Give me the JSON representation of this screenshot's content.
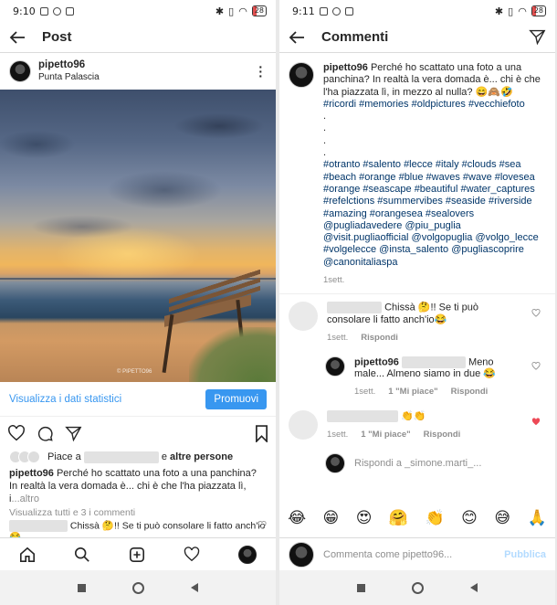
{
  "left": {
    "status": {
      "time": "9:10",
      "battery": "28",
      "battery_level": 0.28
    },
    "topbar": {
      "title": "Post"
    },
    "post": {
      "username": "pipetto96",
      "location": "Punta Palascia",
      "photo_credit": "© PIPETTO96",
      "insights_label": "Visualizza i dati statistici",
      "promote_label": "Promuovi",
      "likes_prefix": "Piace a",
      "likes_and": "e",
      "likes_others": "altre persone",
      "caption_user": "pipetto96",
      "caption_text": "Perché ho scattato una foto a una panchina? In realtà la vera domada è... chi è che l'ha piazzata lì, i",
      "caption_more": "...altro",
      "view_all": "Visualizza tutti e 3 i commenti",
      "preview_comment": "Chissà 🤔!! Se ti può consolare li fatto anch'io😂"
    }
  },
  "right": {
    "status": {
      "time": "9:11",
      "battery": "28",
      "battery_level": 0.28
    },
    "topbar": {
      "title": "Commenti"
    },
    "original": {
      "username": "pipetto96",
      "text": "Perché ho scattato una foto a una panchina? In realtà la vera domada è... chi è che l'ha piazzata lì, in mezzo al nulla? 😄🙈🤣",
      "hashtags_1": "#ricordi #memories #oldpictures #vecchiefoto",
      "dots": [
        ".",
        ".",
        ".",
        "."
      ],
      "hashtags_2": "#otranto #salento #lecce #italy #clouds #sea #beach #orange #blue #waves #wave #lovesea #orange #seascape #beautiful #water_captures #refelctions #summervibes #seaside #riverside #amazing #orangesea #sealovers @pugliadavedere @piu_puglia @visit.pugliaofficial @volgopuglia @volgo_lecce #volgelecce @insta_salento @pugliascoprire @canonitaliaspa",
      "time": "1sett."
    },
    "comments": [
      {
        "text": "Chissà 🤔!! Se ti può consolare li fatto anch'io😂",
        "time": "1sett.",
        "reply_label": "Rispondi",
        "liked": false
      },
      {
        "username": "pipetto96",
        "text": "Meno male... Almeno siamo in due 😂",
        "time": "1sett.",
        "likes": "1 \"Mi piace\"",
        "reply_label": "Rispondi",
        "liked": false
      },
      {
        "text": "👏👏",
        "time": "1sett.",
        "likes": "1 \"Mi piace\"",
        "reply_label": "Rispondi",
        "liked": true
      }
    ],
    "reply_to": "Rispondi a _simone.marti_...",
    "emojis": [
      "😂",
      "😁",
      "😍",
      "🤗",
      "👏",
      "😊",
      "😅",
      "🙏"
    ],
    "compose": {
      "placeholder": "Commenta come pipetto96...",
      "publish": "Pubblica"
    }
  },
  "colors": {
    "link": "#3897f0",
    "hashtag": "#003569",
    "like_red": "#ed4956",
    "muted": "#8e8e8e"
  }
}
